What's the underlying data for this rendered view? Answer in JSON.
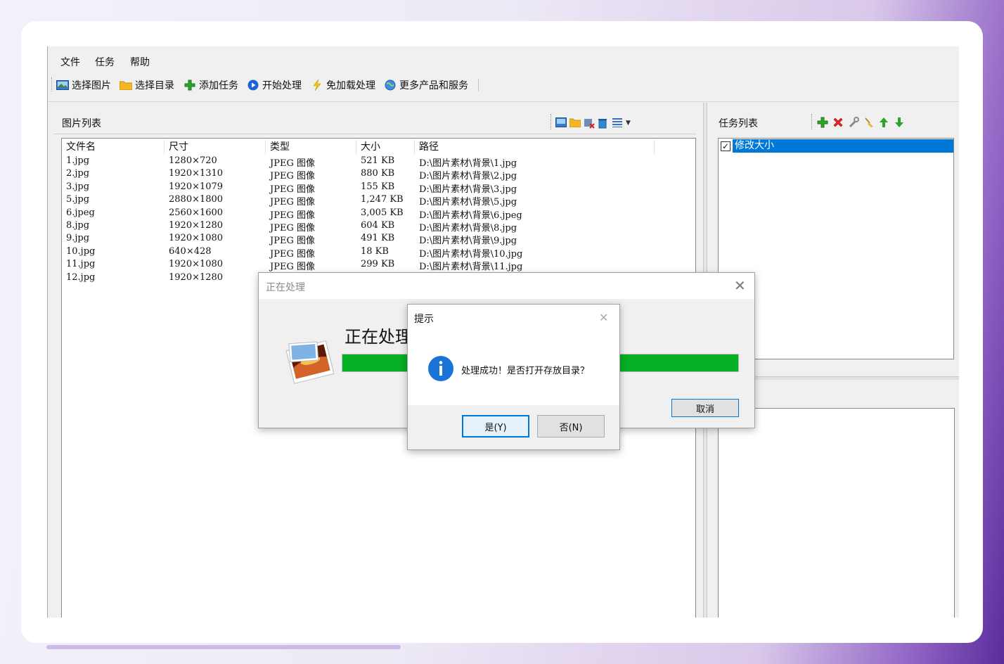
{
  "menu": [
    "文件",
    "任务",
    "帮助"
  ],
  "toolbar": {
    "select_image": "选择图片",
    "select_dir": "选择目录",
    "add_task": "添加任务",
    "start": "开始处理",
    "free_load": "免加载处理",
    "more": "更多产品和服务"
  },
  "image_panel": {
    "title": "图片列表",
    "columns": [
      "文件名",
      "尺寸",
      "类型",
      "大小",
      "路径"
    ],
    "rows": [
      [
        "1.jpg",
        "1280×720",
        "JPEG 图像",
        "521 KB",
        "D:\\图片素材\\背景\\1.jpg"
      ],
      [
        "2.jpg",
        "1920×1310",
        "JPEG 图像",
        "880 KB",
        "D:\\图片素材\\背景\\2.jpg"
      ],
      [
        "3.jpg",
        "1920×1079",
        "JPEG 图像",
        "155 KB",
        "D:\\图片素材\\背景\\3.jpg"
      ],
      [
        "5.jpg",
        "2880×1800",
        "JPEG 图像",
        "1,247 KB",
        "D:\\图片素材\\背景\\5.jpg"
      ],
      [
        "6.jpeg",
        "2560×1600",
        "JPEG 图像",
        "3,005 KB",
        "D:\\图片素材\\背景\\6.jpeg"
      ],
      [
        "8.jpg",
        "1920×1280",
        "JPEG 图像",
        "604 KB",
        "D:\\图片素材\\背景\\8.jpg"
      ],
      [
        "9.jpg",
        "1920×1080",
        "JPEG 图像",
        "491 KB",
        "D:\\图片素材\\背景\\9.jpg"
      ],
      [
        "10.jpg",
        "640×428",
        "JPEG 图像",
        "18 KB",
        "D:\\图片素材\\背景\\10.jpg"
      ],
      [
        "11.jpg",
        "1920×1080",
        "JPEG 图像",
        "299 KB",
        "D:\\图片素材\\背景\\11.jpg"
      ],
      [
        "12.jpg",
        "1920×1280",
        "",
        "",
        ""
      ]
    ]
  },
  "task_panel": {
    "title": "任务列表",
    "items": [
      {
        "label": "修改大小",
        "checked": true
      }
    ]
  },
  "progress_dialog": {
    "title": "正在处理",
    "message": "正在处理",
    "progress": 1.0,
    "cancel": "取消"
  },
  "prompt_dialog": {
    "title": "提示",
    "message": "处理成功！是否打开存放目录？",
    "yes": "是(Y)",
    "no": "否(N)"
  },
  "colors": {
    "progress": "#06b025",
    "selection": "#0078d7",
    "info_icon": "#1a73d6"
  }
}
